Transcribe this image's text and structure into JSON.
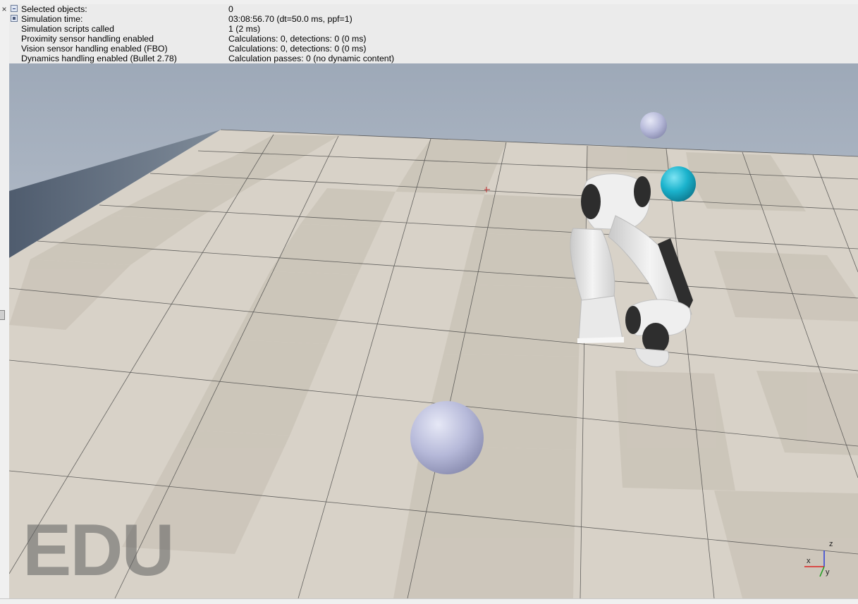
{
  "info_panel": {
    "rows": [
      {
        "label": "Selected objects:",
        "value": "0"
      },
      {
        "label": "Simulation time:",
        "value": "03:08:56.70 (dt=50.0 ms, ppf=1)"
      },
      {
        "label": "Simulation scripts called",
        "value": "1 (2 ms)"
      },
      {
        "label": "Proximity sensor handling enabled",
        "value": "Calculations: 0, detections: 0 (0 ms)"
      },
      {
        "label": "Vision sensor handling enabled (FBO)",
        "value": "Calculations: 0, detections: 0 (0 ms)"
      },
      {
        "label": "Dynamics handling enabled (Bullet 2.78)",
        "value": "Calculation passes: 0 (no dynamic content)"
      }
    ]
  },
  "watermark": "EDU",
  "axes": {
    "x": "x",
    "y": "y",
    "z": "z"
  },
  "colors": {
    "sky_top": "#9aa7b6",
    "sky_bottom": "#d6dce5",
    "floor": "#d9d3ca",
    "tile_alt": "#cdc6bb",
    "cyan_sphere": "#1eb4cf",
    "lavender_sphere": "#b5b8d8",
    "robot_white": "#e8e8e8",
    "robot_black": "#2b2b2b"
  }
}
